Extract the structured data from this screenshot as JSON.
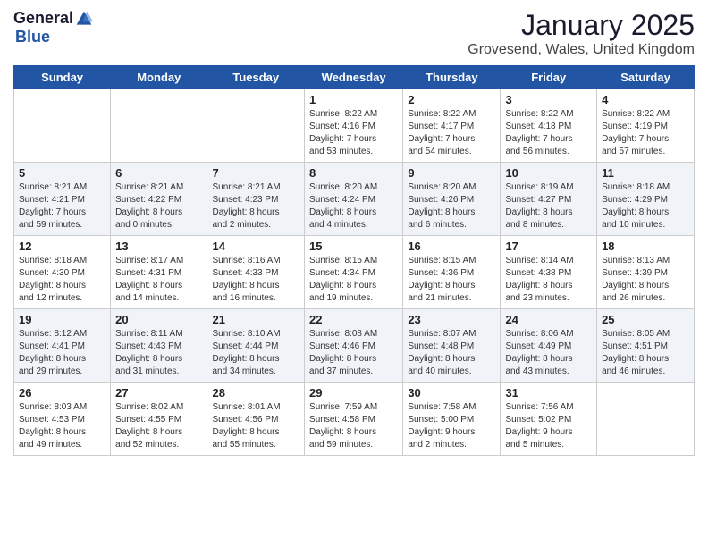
{
  "logo": {
    "general": "General",
    "blue": "Blue"
  },
  "title": "January 2025",
  "subtitle": "Grovesend, Wales, United Kingdom",
  "days_of_week": [
    "Sunday",
    "Monday",
    "Tuesday",
    "Wednesday",
    "Thursday",
    "Friday",
    "Saturday"
  ],
  "weeks": [
    [
      {
        "day": "",
        "info": ""
      },
      {
        "day": "",
        "info": ""
      },
      {
        "day": "",
        "info": ""
      },
      {
        "day": "1",
        "info": "Sunrise: 8:22 AM\nSunset: 4:16 PM\nDaylight: 7 hours\nand 53 minutes."
      },
      {
        "day": "2",
        "info": "Sunrise: 8:22 AM\nSunset: 4:17 PM\nDaylight: 7 hours\nand 54 minutes."
      },
      {
        "day": "3",
        "info": "Sunrise: 8:22 AM\nSunset: 4:18 PM\nDaylight: 7 hours\nand 56 minutes."
      },
      {
        "day": "4",
        "info": "Sunrise: 8:22 AM\nSunset: 4:19 PM\nDaylight: 7 hours\nand 57 minutes."
      }
    ],
    [
      {
        "day": "5",
        "info": "Sunrise: 8:21 AM\nSunset: 4:21 PM\nDaylight: 7 hours\nand 59 minutes."
      },
      {
        "day": "6",
        "info": "Sunrise: 8:21 AM\nSunset: 4:22 PM\nDaylight: 8 hours\nand 0 minutes."
      },
      {
        "day": "7",
        "info": "Sunrise: 8:21 AM\nSunset: 4:23 PM\nDaylight: 8 hours\nand 2 minutes."
      },
      {
        "day": "8",
        "info": "Sunrise: 8:20 AM\nSunset: 4:24 PM\nDaylight: 8 hours\nand 4 minutes."
      },
      {
        "day": "9",
        "info": "Sunrise: 8:20 AM\nSunset: 4:26 PM\nDaylight: 8 hours\nand 6 minutes."
      },
      {
        "day": "10",
        "info": "Sunrise: 8:19 AM\nSunset: 4:27 PM\nDaylight: 8 hours\nand 8 minutes."
      },
      {
        "day": "11",
        "info": "Sunrise: 8:18 AM\nSunset: 4:29 PM\nDaylight: 8 hours\nand 10 minutes."
      }
    ],
    [
      {
        "day": "12",
        "info": "Sunrise: 8:18 AM\nSunset: 4:30 PM\nDaylight: 8 hours\nand 12 minutes."
      },
      {
        "day": "13",
        "info": "Sunrise: 8:17 AM\nSunset: 4:31 PM\nDaylight: 8 hours\nand 14 minutes."
      },
      {
        "day": "14",
        "info": "Sunrise: 8:16 AM\nSunset: 4:33 PM\nDaylight: 8 hours\nand 16 minutes."
      },
      {
        "day": "15",
        "info": "Sunrise: 8:15 AM\nSunset: 4:34 PM\nDaylight: 8 hours\nand 19 minutes."
      },
      {
        "day": "16",
        "info": "Sunrise: 8:15 AM\nSunset: 4:36 PM\nDaylight: 8 hours\nand 21 minutes."
      },
      {
        "day": "17",
        "info": "Sunrise: 8:14 AM\nSunset: 4:38 PM\nDaylight: 8 hours\nand 23 minutes."
      },
      {
        "day": "18",
        "info": "Sunrise: 8:13 AM\nSunset: 4:39 PM\nDaylight: 8 hours\nand 26 minutes."
      }
    ],
    [
      {
        "day": "19",
        "info": "Sunrise: 8:12 AM\nSunset: 4:41 PM\nDaylight: 8 hours\nand 29 minutes."
      },
      {
        "day": "20",
        "info": "Sunrise: 8:11 AM\nSunset: 4:43 PM\nDaylight: 8 hours\nand 31 minutes."
      },
      {
        "day": "21",
        "info": "Sunrise: 8:10 AM\nSunset: 4:44 PM\nDaylight: 8 hours\nand 34 minutes."
      },
      {
        "day": "22",
        "info": "Sunrise: 8:08 AM\nSunset: 4:46 PM\nDaylight: 8 hours\nand 37 minutes."
      },
      {
        "day": "23",
        "info": "Sunrise: 8:07 AM\nSunset: 4:48 PM\nDaylight: 8 hours\nand 40 minutes."
      },
      {
        "day": "24",
        "info": "Sunrise: 8:06 AM\nSunset: 4:49 PM\nDaylight: 8 hours\nand 43 minutes."
      },
      {
        "day": "25",
        "info": "Sunrise: 8:05 AM\nSunset: 4:51 PM\nDaylight: 8 hours\nand 46 minutes."
      }
    ],
    [
      {
        "day": "26",
        "info": "Sunrise: 8:03 AM\nSunset: 4:53 PM\nDaylight: 8 hours\nand 49 minutes."
      },
      {
        "day": "27",
        "info": "Sunrise: 8:02 AM\nSunset: 4:55 PM\nDaylight: 8 hours\nand 52 minutes."
      },
      {
        "day": "28",
        "info": "Sunrise: 8:01 AM\nSunset: 4:56 PM\nDaylight: 8 hours\nand 55 minutes."
      },
      {
        "day": "29",
        "info": "Sunrise: 7:59 AM\nSunset: 4:58 PM\nDaylight: 8 hours\nand 59 minutes."
      },
      {
        "day": "30",
        "info": "Sunrise: 7:58 AM\nSunset: 5:00 PM\nDaylight: 9 hours\nand 2 minutes."
      },
      {
        "day": "31",
        "info": "Sunrise: 7:56 AM\nSunset: 5:02 PM\nDaylight: 9 hours\nand 5 minutes."
      },
      {
        "day": "",
        "info": ""
      }
    ]
  ]
}
